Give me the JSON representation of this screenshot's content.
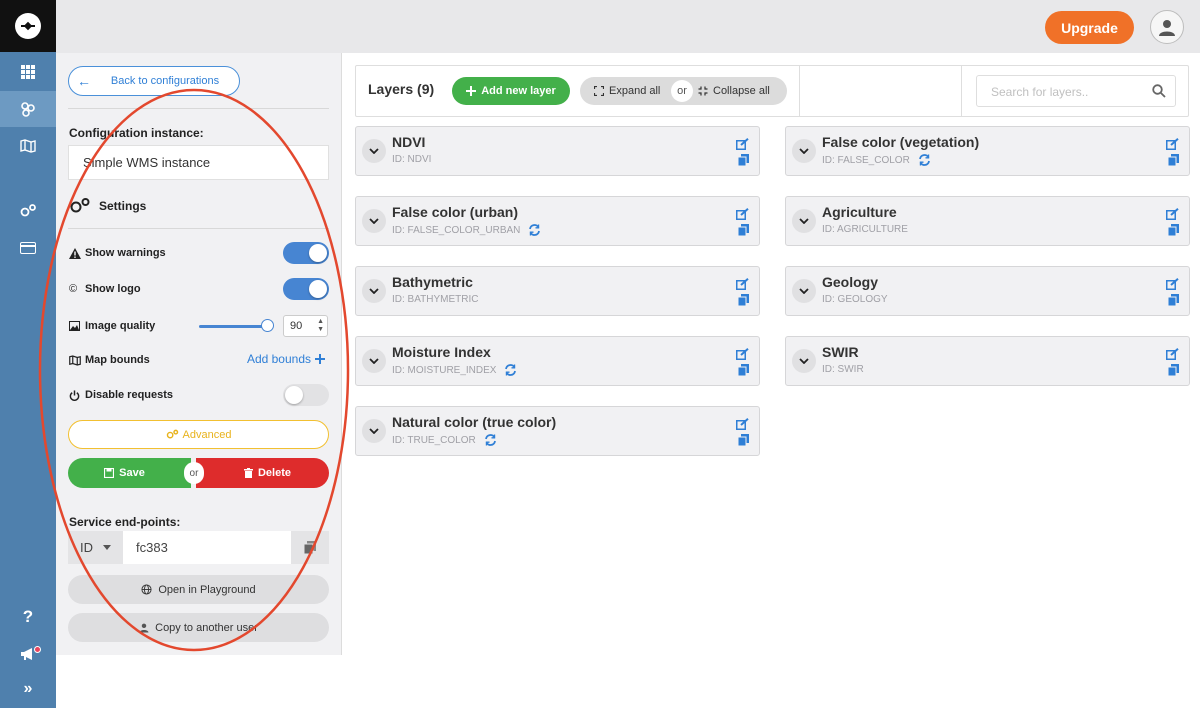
{
  "colors": {
    "rail": "#4f80ad",
    "accent_blue": "#4785d2",
    "upgrade": "#f07128",
    "save": "#43b04a",
    "delete": "#de2c2c",
    "advanced": "#f2c031"
  },
  "topbar": {
    "upgrade_label": "Upgrade"
  },
  "rail": {
    "help_label": "?",
    "expand_label": "»"
  },
  "panel": {
    "back_label": "Back to configurations",
    "config_label": "Configuration instance:",
    "config_value": "Simple WMS instance",
    "settings_label": "Settings",
    "show_warnings": {
      "label": "Show warnings",
      "on": true
    },
    "show_logo": {
      "label": "Show logo",
      "on": true
    },
    "image_quality": {
      "label": "Image quality",
      "value": "90"
    },
    "map_bounds": {
      "label": "Map bounds",
      "action": "Add bounds"
    },
    "disable_requests": {
      "label": "Disable requests",
      "on": false
    },
    "advanced_label": "Advanced",
    "save_label": "Save",
    "or_label": "or",
    "delete_label": "Delete",
    "service_label": "Service end-points:",
    "service_type": "ID",
    "service_value": "fc383",
    "playground_label": "Open in Playground",
    "copy_user_label": "Copy to another user"
  },
  "layers": {
    "title": "Layers (9)",
    "add_label": "Add new layer",
    "expand_label": "Expand all",
    "or_label": "or",
    "collapse_label": "Collapse all",
    "search_placeholder": "Search for layers.."
  },
  "cards": [
    {
      "name": "NDVI",
      "id": "ID: NDVI",
      "sync": false
    },
    {
      "name": "False color (vegetation)",
      "id": "ID: FALSE_COLOR",
      "sync": true
    },
    {
      "name": "False color (urban)",
      "id": "ID: FALSE_COLOR_URBAN",
      "sync": true
    },
    {
      "name": "Agriculture",
      "id": "ID: AGRICULTURE",
      "sync": false
    },
    {
      "name": "Bathymetric",
      "id": "ID: BATHYMETRIC",
      "sync": false
    },
    {
      "name": "Geology",
      "id": "ID: GEOLOGY",
      "sync": false
    },
    {
      "name": "Moisture Index",
      "id": "ID: MOISTURE_INDEX",
      "sync": true
    },
    {
      "name": "SWIR",
      "id": "ID: SWIR",
      "sync": false
    },
    {
      "name": "Natural color (true color)",
      "id": "ID: TRUE_COLOR",
      "sync": true
    }
  ]
}
